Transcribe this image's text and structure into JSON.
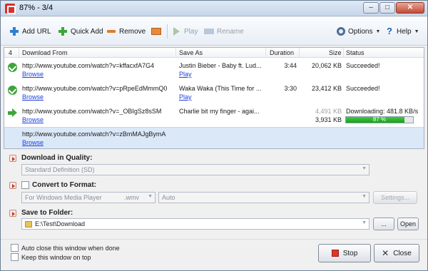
{
  "window": {
    "title": "87% - 3/4",
    "min": "–",
    "max": "□",
    "close": "✕"
  },
  "toolbar": {
    "add_url": "Add URL",
    "quick_add": "Quick Add",
    "remove": "Remove",
    "play": "Play",
    "rename": "Rename",
    "options": "Options",
    "help": "Help",
    "help_glyph": "?"
  },
  "list": {
    "headers": {
      "count": "4",
      "from": "Download From",
      "save_as": "Save As",
      "duration": "Duration",
      "size": "Size",
      "status": "Status"
    },
    "rows": [
      {
        "url": "http://www.youtube.com/watch?v=kffacxfA7G4",
        "browse": "Browse",
        "save_as": "Justin Bieber - Baby ft. Lud...",
        "play": "Play",
        "duration": "3:44",
        "size": "20,062 KB",
        "status": "Succeeded!"
      },
      {
        "url": "http://www.youtube.com/watch?v=pRpeEdMmmQ0",
        "browse": "Browse",
        "save_as": "Waka Waka (This Time for ...",
        "play": "Play",
        "duration": "3:30",
        "size": "23,412 KB",
        "status": "Succeeded!"
      },
      {
        "url": "http://www.youtube.com/watch?v=_OBIgSz8sSM",
        "browse": "Browse",
        "save_as": "Charlie bit my finger - agai...",
        "duration": "",
        "size_total": "4,491 KB",
        "size": "3,931 KB",
        "status": "Downloading: 481.8 KB/s",
        "progress": 0.87,
        "progress_text": "87 %"
      },
      {
        "url": "http://www.youtube.com/watch?v=zBmMAJgBymA",
        "browse": "Browse"
      }
    ]
  },
  "quality": {
    "label": "Download in Quality:",
    "value": "Standard Definition (SD)"
  },
  "convert": {
    "label": "Convert to Format:",
    "format": "For Windows Media Player",
    "ext": ".wmv",
    "preset": "Auto",
    "settings": "Settings..."
  },
  "folder": {
    "label": "Save to Folder:",
    "path": "E:\\Test\\Download",
    "browse": "...",
    "open": "Open"
  },
  "footer": {
    "auto_close": "Auto close this window when done",
    "keep_on_top": "Keep this window on top",
    "stop": "Stop",
    "close": "Close"
  },
  "colors": {
    "accent": "#1e3fd6",
    "progress": "#28b028",
    "stop": "#e0352b"
  }
}
